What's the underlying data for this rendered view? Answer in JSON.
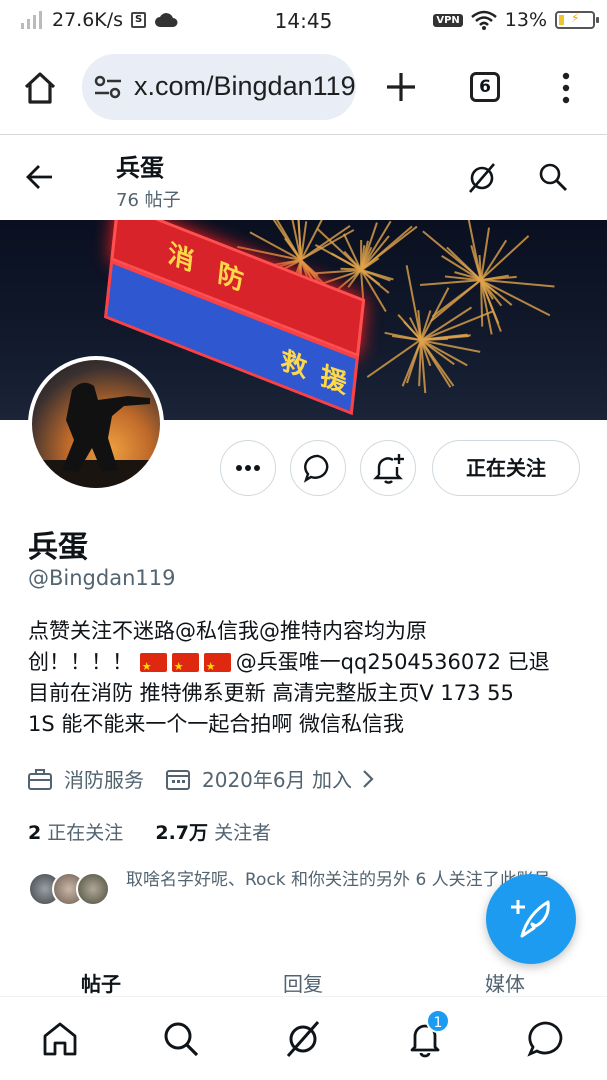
{
  "status_bar": {
    "speed": "27.6K/s",
    "time": "14:45",
    "vpn": "VPN",
    "battery": "13%"
  },
  "browser": {
    "url": "x.com/Bingdan119",
    "tab_count": "6"
  },
  "header": {
    "name": "兵蛋",
    "post_count": "76 帖子"
  },
  "banner": {
    "sign_text": [
      "消",
      "防",
      "救",
      "援"
    ]
  },
  "profile": {
    "name": "兵蛋",
    "handle": "@Bingdan119",
    "follow_label": "正在关注",
    "bio_lines": [
      "点赞关注不迷路@私信我@推特内容均为原",
      "创！！！！",
      "@兵蛋唯一qq2504536072 已退",
      "目前在消防 推特佛系更新 高清完整版主页V 173 55",
      "1S 能不能来一个一起合拍啊 微信私信我"
    ],
    "category": "消防服务",
    "joined": "2020年6月 加入",
    "following_count": "2",
    "following_label": "正在关注",
    "followers_count": "2.7万",
    "followers_label": "关注者",
    "known_followers": "取啥名字好呢、Rock 和你关注的另外 6 人关注了此账号"
  },
  "tabs": [
    {
      "label": "帖子"
    },
    {
      "label": "回复"
    },
    {
      "label": "媒体"
    }
  ],
  "bottom_nav": {
    "notification_badge": "1"
  },
  "colors": {
    "accent": "#1d9bf0",
    "text": "#0f1419",
    "secondary": "#536471"
  }
}
